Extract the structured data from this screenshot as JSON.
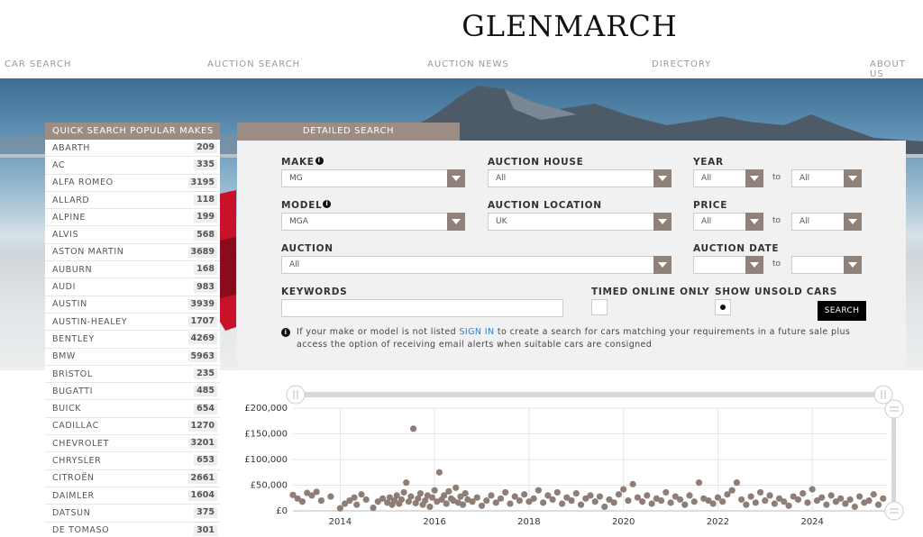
{
  "brand": "GLENMARCH",
  "nav": [
    "CAR SEARCH",
    "AUCTION SEARCH",
    "AUCTION NEWS",
    "DIRECTORY",
    "ABOUT US"
  ],
  "quick_search": {
    "title": "QUICK SEARCH POPULAR MAKES",
    "makes": [
      {
        "name": "ABARTH",
        "count": "209"
      },
      {
        "name": "AC",
        "count": "335"
      },
      {
        "name": "ALFA ROMEO",
        "count": "3195"
      },
      {
        "name": "ALLARD",
        "count": "118"
      },
      {
        "name": "ALPINE",
        "count": "199"
      },
      {
        "name": "ALVIS",
        "count": "568"
      },
      {
        "name": "ASTON MARTIN",
        "count": "3689"
      },
      {
        "name": "AUBURN",
        "count": "168"
      },
      {
        "name": "AUDI",
        "count": "983"
      },
      {
        "name": "AUSTIN",
        "count": "3939"
      },
      {
        "name": "AUSTIN-HEALEY",
        "count": "1707"
      },
      {
        "name": "BENTLEY",
        "count": "4269"
      },
      {
        "name": "BMW",
        "count": "5963"
      },
      {
        "name": "BRISTOL",
        "count": "235"
      },
      {
        "name": "BUGATTI",
        "count": "485"
      },
      {
        "name": "BUICK",
        "count": "654"
      },
      {
        "name": "CADILLAC",
        "count": "1270"
      },
      {
        "name": "CHEVROLET",
        "count": "3201"
      },
      {
        "name": "CHRYSLER",
        "count": "653"
      },
      {
        "name": "CITROËN",
        "count": "2661"
      },
      {
        "name": "DAIMLER",
        "count": "1604"
      },
      {
        "name": "DATSUN",
        "count": "375"
      },
      {
        "name": "DE TOMASO",
        "count": "301"
      }
    ]
  },
  "detailed_search": {
    "tab": "DETAILED SEARCH",
    "make_label": "MAKE",
    "make_value": "MG",
    "model_label": "MODEL",
    "model_value": "MGA",
    "auction_house_label": "AUCTION HOUSE",
    "auction_house_value": "All",
    "auction_location_label": "AUCTION LOCATION",
    "auction_location_value": "UK",
    "auction_label": "AUCTION",
    "auction_value": "All",
    "year_label": "YEAR",
    "year_from": "All",
    "year_to": "All",
    "price_label": "PRICE",
    "price_from": "All",
    "price_to": "All",
    "auction_date_label": "AUCTION DATE",
    "date_from": "",
    "date_to": "",
    "to": "to",
    "keywords_label": "KEYWORDS",
    "keywords_value": "",
    "timed_online_label": "TIMED ONLINE ONLY",
    "show_unsold_label": "SHOW UNSOLD CARS",
    "search_button": "SEARCH",
    "note_before": "If your make or model is not listed ",
    "note_link": "SIGN IN",
    "note_after": " to create a search for cars matching your requirements in a future sale plus access the option of receiving email alerts when suitable cars are consigned"
  },
  "colors": {
    "accent": "#9b8c84",
    "select_arrow": "#8f827b",
    "dot": "#8e7e75",
    "link": "#3b7cc4"
  },
  "chart_data": {
    "type": "scatter",
    "y_ticks": [
      "£200,000",
      "£150,000",
      "£100,000",
      "£50,000",
      "£0"
    ],
    "x_ticks": [
      "2014",
      "2016",
      "2018",
      "2020",
      "2022",
      "2024"
    ],
    "xlim": [
      2013.0,
      2025.6
    ],
    "ylim": [
      0,
      200000
    ],
    "points": [
      [
        2013.0,
        31000
      ],
      [
        2013.1,
        24000
      ],
      [
        2013.2,
        18000
      ],
      [
        2013.3,
        35000
      ],
      [
        2013.4,
        30000
      ],
      [
        2013.5,
        37000
      ],
      [
        2013.6,
        20000
      ],
      [
        2013.8,
        28000
      ],
      [
        2014.0,
        5000
      ],
      [
        2014.1,
        14000
      ],
      [
        2014.2,
        20000
      ],
      [
        2014.3,
        26000
      ],
      [
        2014.35,
        12000
      ],
      [
        2014.45,
        32000
      ],
      [
        2014.55,
        22000
      ],
      [
        2014.7,
        6000
      ],
      [
        2014.8,
        18000
      ],
      [
        2014.9,
        24000
      ],
      [
        2015.0,
        16000
      ],
      [
        2015.05,
        26000
      ],
      [
        2015.1,
        12000
      ],
      [
        2015.15,
        20000
      ],
      [
        2015.2,
        30000
      ],
      [
        2015.25,
        14000
      ],
      [
        2015.3,
        22000
      ],
      [
        2015.35,
        36000
      ],
      [
        2015.4,
        55000
      ],
      [
        2015.45,
        18000
      ],
      [
        2015.5,
        28000
      ],
      [
        2015.55,
        160000
      ],
      [
        2015.6,
        15000
      ],
      [
        2015.65,
        24000
      ],
      [
        2015.7,
        34000
      ],
      [
        2015.75,
        12000
      ],
      [
        2015.8,
        20000
      ],
      [
        2015.85,
        30000
      ],
      [
        2015.9,
        8000
      ],
      [
        2015.95,
        26000
      ],
      [
        2016.0,
        40000
      ],
      [
        2016.05,
        18000
      ],
      [
        2016.1,
        75000
      ],
      [
        2016.15,
        22000
      ],
      [
        2016.2,
        30000
      ],
      [
        2016.25,
        14000
      ],
      [
        2016.3,
        38000
      ],
      [
        2016.35,
        24000
      ],
      [
        2016.4,
        20000
      ],
      [
        2016.45,
        45000
      ],
      [
        2016.5,
        16000
      ],
      [
        2016.55,
        28000
      ],
      [
        2016.6,
        12000
      ],
      [
        2016.65,
        34000
      ],
      [
        2016.7,
        22000
      ],
      [
        2016.8,
        18000
      ],
      [
        2016.9,
        26000
      ],
      [
        2017.0,
        10000
      ],
      [
        2017.1,
        20000
      ],
      [
        2017.2,
        30000
      ],
      [
        2017.3,
        16000
      ],
      [
        2017.4,
        24000
      ],
      [
        2017.5,
        36000
      ],
      [
        2017.6,
        14000
      ],
      [
        2017.7,
        28000
      ],
      [
        2017.8,
        20000
      ],
      [
        2017.9,
        32000
      ],
      [
        2018.0,
        18000
      ],
      [
        2018.1,
        24000
      ],
      [
        2018.2,
        40000
      ],
      [
        2018.3,
        16000
      ],
      [
        2018.4,
        30000
      ],
      [
        2018.5,
        22000
      ],
      [
        2018.6,
        36000
      ],
      [
        2018.7,
        14000
      ],
      [
        2018.8,
        26000
      ],
      [
        2018.9,
        20000
      ],
      [
        2019.0,
        34000
      ],
      [
        2019.1,
        12000
      ],
      [
        2019.2,
        24000
      ],
      [
        2019.3,
        30000
      ],
      [
        2019.4,
        18000
      ],
      [
        2019.5,
        28000
      ],
      [
        2019.6,
        8000
      ],
      [
        2019.7,
        22000
      ],
      [
        2019.8,
        16000
      ],
      [
        2019.9,
        32000
      ],
      [
        2020.0,
        42000
      ],
      [
        2020.1,
        20000
      ],
      [
        2020.2,
        52000
      ],
      [
        2020.3,
        26000
      ],
      [
        2020.4,
        18000
      ],
      [
        2020.5,
        30000
      ],
      [
        2020.6,
        14000
      ],
      [
        2020.7,
        24000
      ],
      [
        2020.8,
        20000
      ],
      [
        2020.9,
        36000
      ],
      [
        2021.0,
        16000
      ],
      [
        2021.1,
        28000
      ],
      [
        2021.2,
        22000
      ],
      [
        2021.3,
        12000
      ],
      [
        2021.4,
        30000
      ],
      [
        2021.5,
        18000
      ],
      [
        2021.6,
        55000
      ],
      [
        2021.7,
        24000
      ],
      [
        2021.8,
        20000
      ],
      [
        2021.9,
        14000
      ],
      [
        2022.0,
        26000
      ],
      [
        2022.1,
        18000
      ],
      [
        2022.2,
        32000
      ],
      [
        2022.3,
        40000
      ],
      [
        2022.4,
        55000
      ],
      [
        2022.5,
        22000
      ],
      [
        2022.6,
        12000
      ],
      [
        2022.7,
        28000
      ],
      [
        2022.8,
        16000
      ],
      [
        2022.9,
        36000
      ],
      [
        2023.0,
        20000
      ],
      [
        2023.1,
        30000
      ],
      [
        2023.2,
        14000
      ],
      [
        2023.3,
        24000
      ],
      [
        2023.4,
        18000
      ],
      [
        2023.5,
        10000
      ],
      [
        2023.6,
        28000
      ],
      [
        2023.7,
        22000
      ],
      [
        2023.8,
        34000
      ],
      [
        2023.9,
        16000
      ],
      [
        2024.0,
        42000
      ],
      [
        2024.1,
        20000
      ],
      [
        2024.2,
        26000
      ],
      [
        2024.3,
        12000
      ],
      [
        2024.4,
        30000
      ],
      [
        2024.5,
        18000
      ],
      [
        2024.6,
        24000
      ],
      [
        2024.7,
        14000
      ],
      [
        2024.8,
        22000
      ],
      [
        2024.9,
        8000
      ],
      [
        2025.0,
        28000
      ],
      [
        2025.1,
        16000
      ],
      [
        2025.2,
        20000
      ],
      [
        2025.3,
        32000
      ],
      [
        2025.4,
        12000
      ],
      [
        2025.5,
        24000
      ]
    ]
  }
}
